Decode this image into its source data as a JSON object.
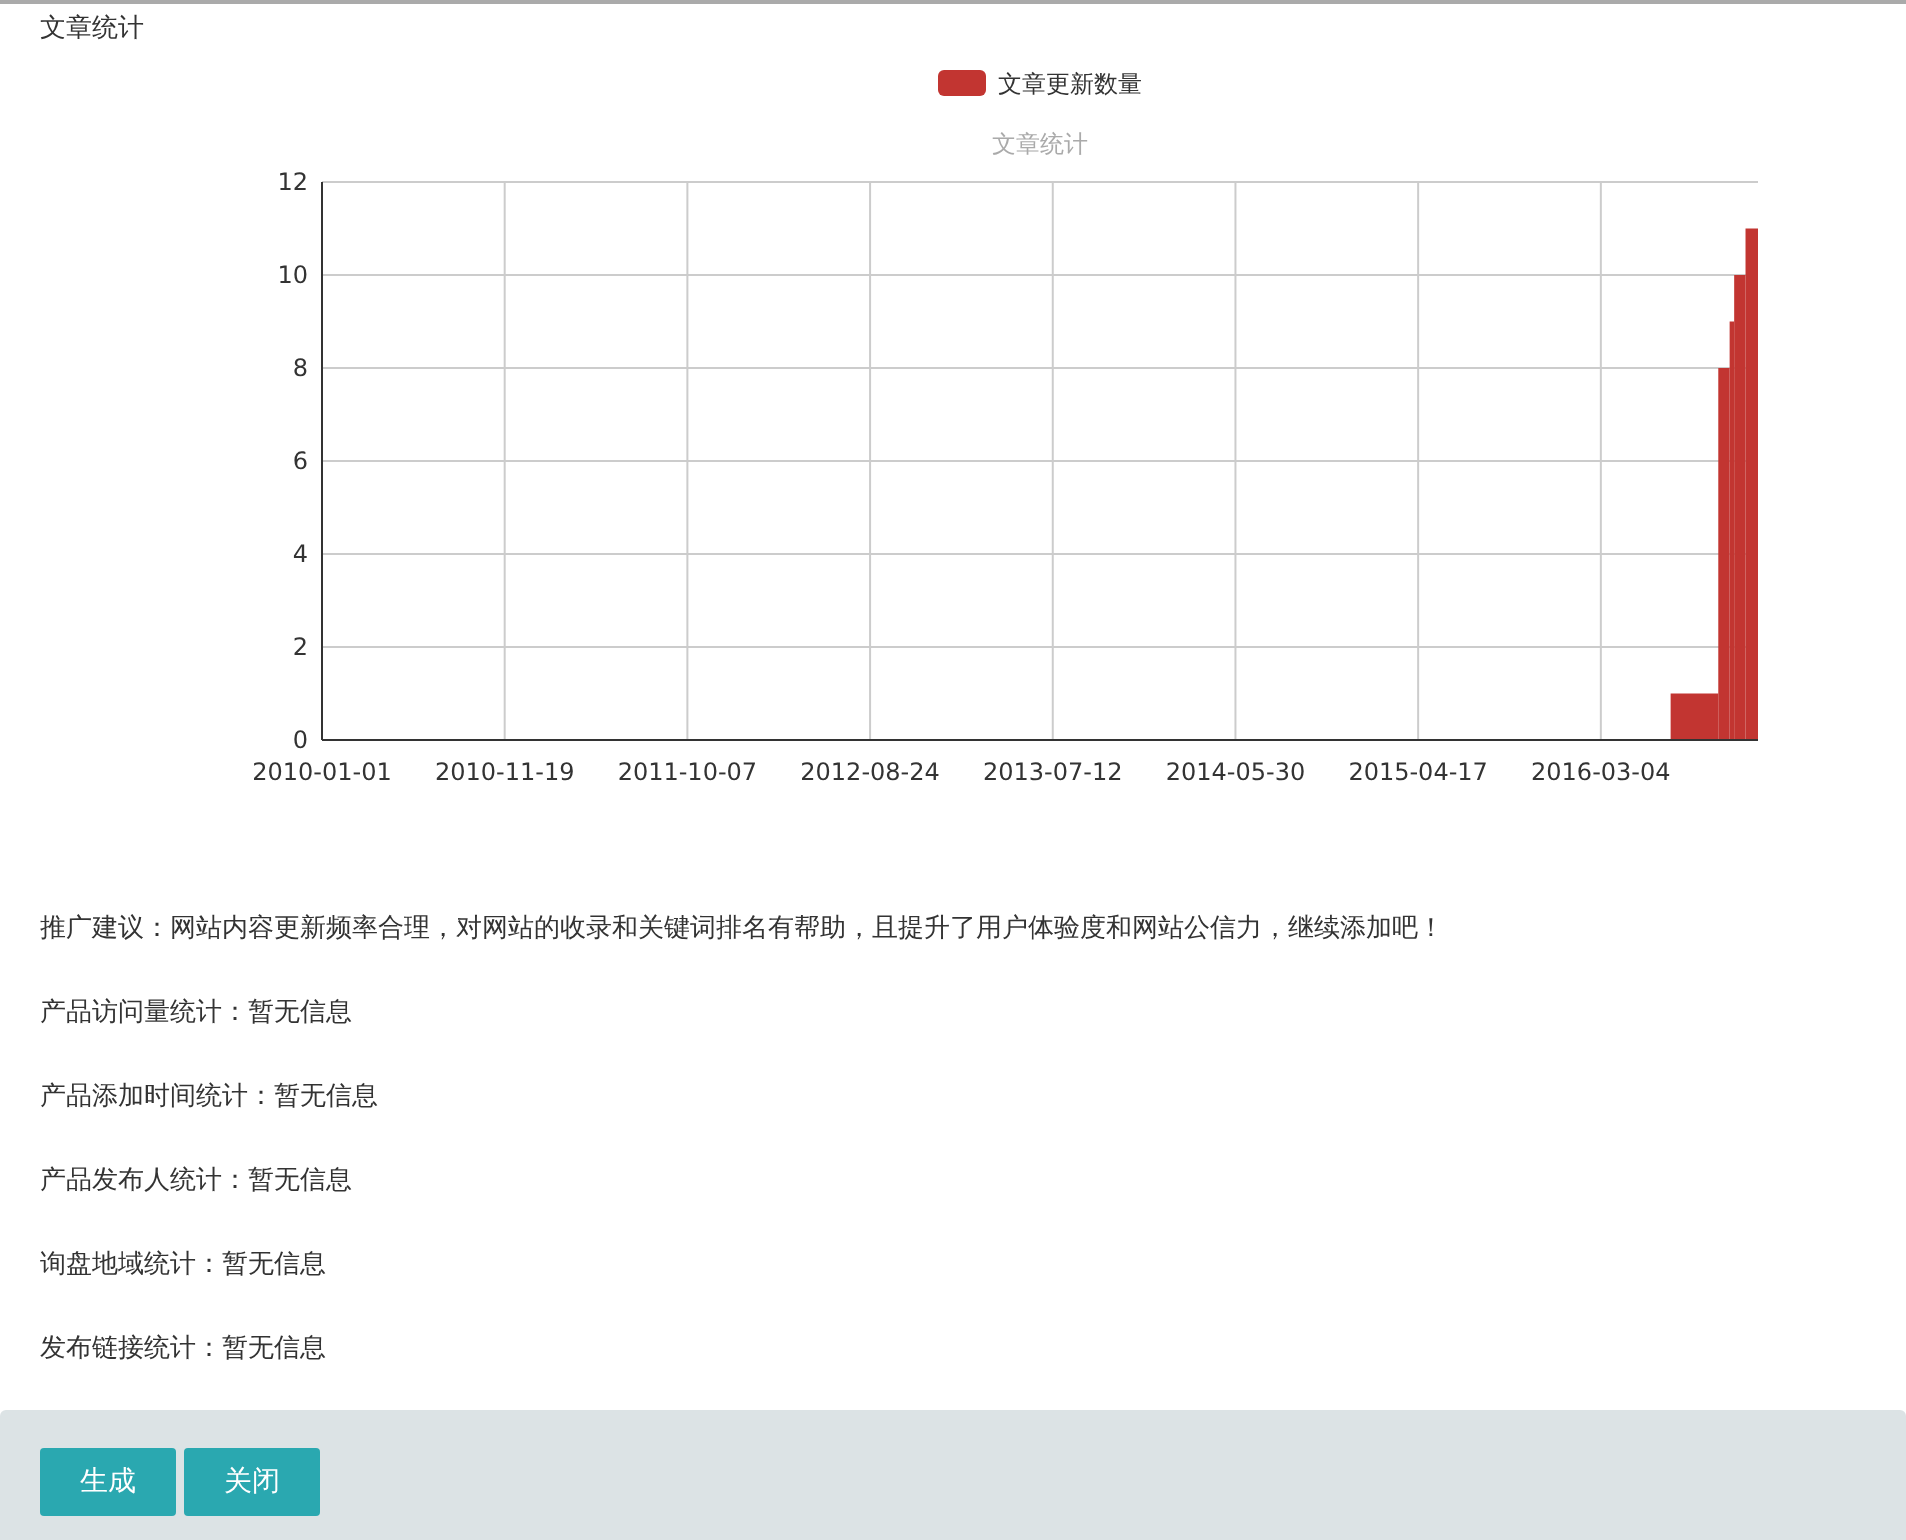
{
  "section_title": "文章统计",
  "chart_data": {
    "type": "bar",
    "title": "文章统计",
    "grid": true,
    "x": [
      "2016-08-16",
      "2016-10-07",
      "2016-10-21",
      "2016-11-04",
      "2016-11-25"
    ],
    "series": [
      {
        "name": "文章更新数量",
        "color": "#c23531",
        "values": [
          1,
          8,
          9,
          10,
          11
        ]
      }
    ],
    "xlim": [
      "2010-01-01",
      "2016-12-06"
    ],
    "xticks": [
      {
        "value": "2010-01-01",
        "label": "2010-01-01"
      },
      {
        "value": "2010-11-19",
        "label": "2010-11-19"
      },
      {
        "value": "2011-10-07",
        "label": "2011-10-07"
      },
      {
        "value": "2012-08-24",
        "label": "2012-08-24"
      },
      {
        "value": "2013-07-12",
        "label": "2013-07-12"
      },
      {
        "value": "2014-05-30",
        "label": "2014-05-30"
      },
      {
        "value": "2015-04-17",
        "label": "2015-04-17"
      },
      {
        "value": "2016-03-04",
        "label": "2016-03-04"
      }
    ],
    "ylim": [
      0,
      12
    ],
    "yticks": [
      0,
      2,
      4,
      6,
      8,
      10,
      12
    ]
  },
  "advice": "推广建议：网站内容更新频率合理，对网站的收录和关键词排名有帮助，且提升了用户体验度和网站公信力，继续添加吧！",
  "stats": [
    {
      "label": "产品访问量统计：",
      "value": "暂无信息"
    },
    {
      "label": "产品添加时间统计：",
      "value": "暂无信息"
    },
    {
      "label": "产品发布人统计：",
      "value": "暂无信息"
    },
    {
      "label": "询盘地域统计：",
      "value": "暂无信息"
    },
    {
      "label": "发布链接统计：",
      "value": "暂无信息"
    }
  ],
  "buttons": [
    "生成",
    "关闭"
  ]
}
